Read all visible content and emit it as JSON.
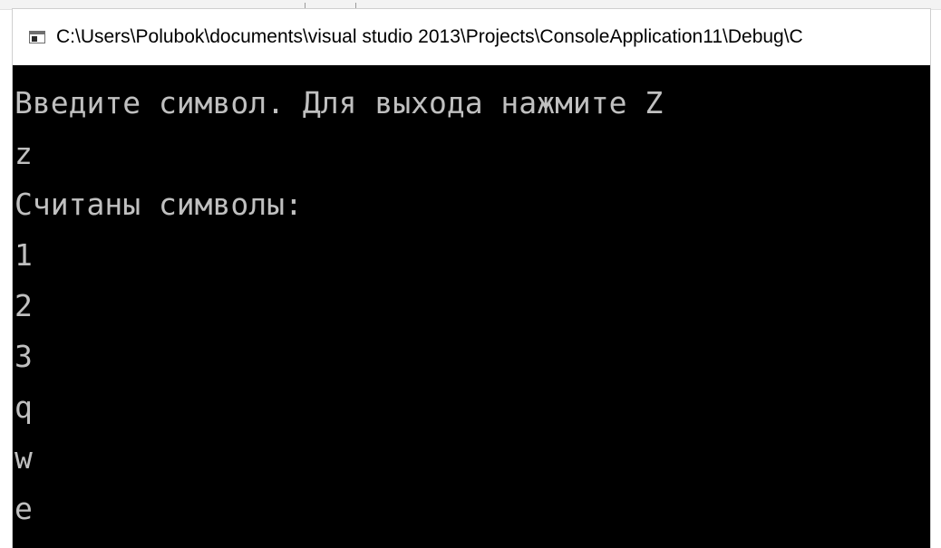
{
  "window": {
    "title": "C:\\Users\\Polubok\\documents\\visual studio 2013\\Projects\\ConsoleApplication11\\Debug\\C"
  },
  "console": {
    "lines": [
      "Введите символ. Для выхода нажмите Z",
      "z",
      "Считаны символы:",
      "1",
      "2",
      "3",
      "q",
      "w",
      "e"
    ]
  },
  "colors": {
    "console_background": "#000000",
    "console_text": "#c0c0c0",
    "titlebar_background": "#ffffff"
  },
  "icons": {
    "titlebar": "console-app-icon"
  }
}
